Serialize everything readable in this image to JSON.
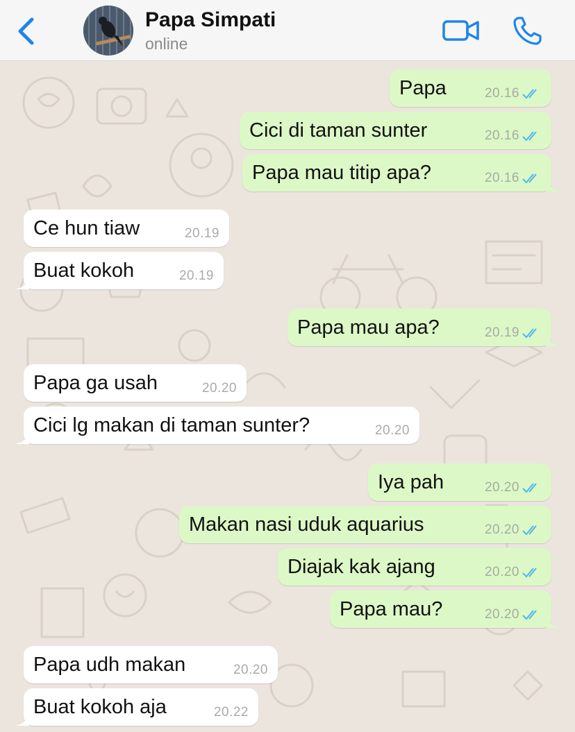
{
  "header": {
    "contact_name": "Papa Simpati",
    "status": "online",
    "back_icon": "chevron-left-icon",
    "video_icon": "video-camera-icon",
    "call_icon": "phone-icon",
    "accent_color": "#1f84ea"
  },
  "colors": {
    "outgoing_bubble": "#dcf8c6",
    "incoming_bubble": "#ffffff",
    "read_ticks": "#4fb6ec",
    "wallpaper": "#ebe5de"
  },
  "messages": [
    {
      "direction": "out",
      "text": "Papa",
      "time": "20.16"
    },
    {
      "direction": "out",
      "text": "Cici di taman sunter",
      "time": "20.16"
    },
    {
      "direction": "out",
      "text": "Papa mau titip apa?",
      "time": "20.16"
    },
    {
      "direction": "in",
      "text": "Ce hun tiaw",
      "time": "20.19"
    },
    {
      "direction": "in",
      "text": "Buat kokoh",
      "time": "20.19"
    },
    {
      "direction": "out",
      "text": "Papa mau apa?",
      "time": "20.19"
    },
    {
      "direction": "in",
      "text": "Papa ga usah",
      "time": "20.20"
    },
    {
      "direction": "in",
      "text": "Cici lg makan di taman sunter?",
      "time": "20.20"
    },
    {
      "direction": "out",
      "text": "Iya pah",
      "time": "20.20"
    },
    {
      "direction": "out",
      "text": "Makan nasi uduk aquarius",
      "time": "20.20"
    },
    {
      "direction": "out",
      "text": "Diajak kak ajang",
      "time": "20.20"
    },
    {
      "direction": "out",
      "text": "Papa mau?",
      "time": "20.20"
    },
    {
      "direction": "in",
      "text": "Papa udh makan",
      "time": "20.20"
    },
    {
      "direction": "in",
      "text": "Buat kokoh aja",
      "time": "20.22"
    }
  ]
}
